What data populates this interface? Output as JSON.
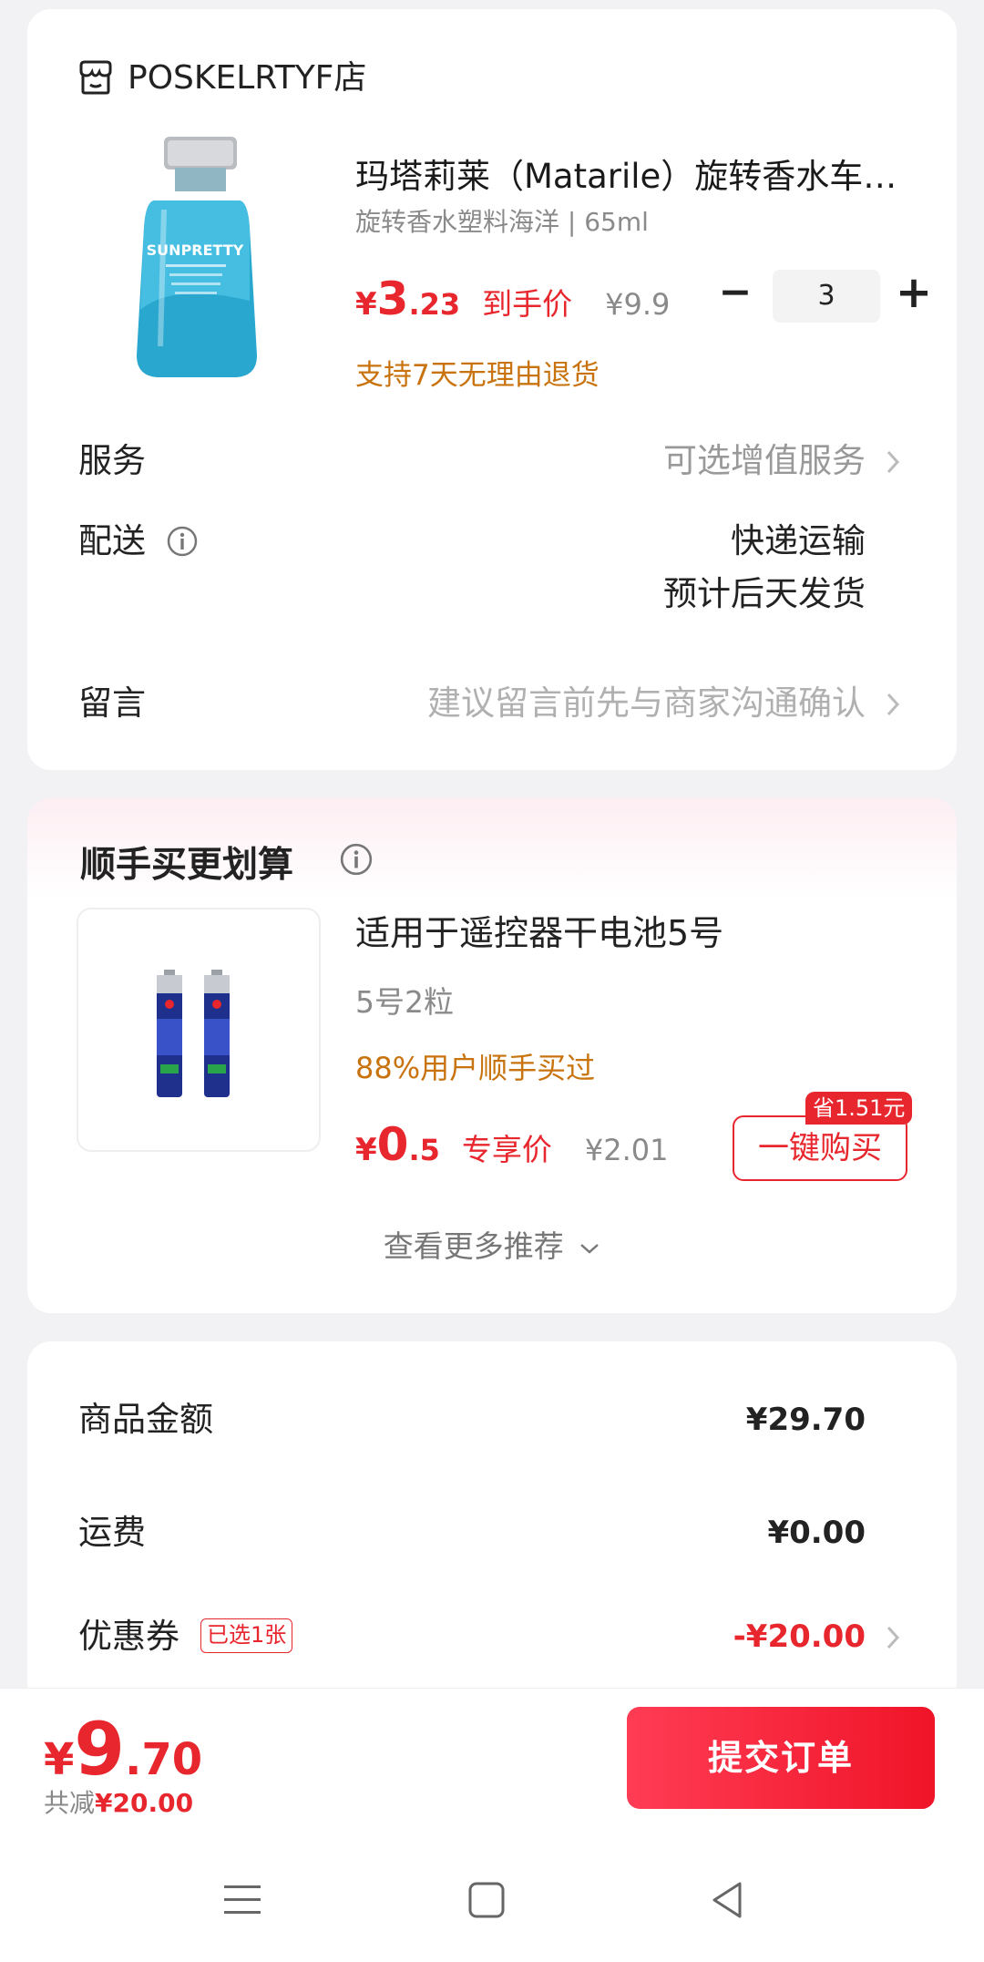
{
  "store": {
    "name": "POSKELRTYF店"
  },
  "product": {
    "title": "玛塔莉莱（Matarile）旋转香水车…",
    "spec": "旋转香水塑料海洋 | 65ml",
    "price_symbol": "¥",
    "price_int": "3",
    "price_dec": ".23",
    "price_tag": "到手价",
    "original_price": "¥9.9",
    "quantity": "3",
    "minus_symbol": "−",
    "plus_symbol": "+",
    "return_note": "支持7天无理由退货",
    "image_label": "SUNPRETTY"
  },
  "rows": {
    "service_label": "服务",
    "service_value": "可选增值服务",
    "delivery_label": "配送",
    "delivery_method": "快递运输",
    "delivery_eta": "预计后天发货",
    "message_label": "留言",
    "message_placeholder": "建议留言前先与商家沟通确认"
  },
  "recommend": {
    "title": "顺手买更划算",
    "item": {
      "name": "适用于遥控器干电池5号",
      "spec": "5号2粒",
      "bought": "88%用户顺手买过",
      "price_symbol": "¥",
      "price_int": "0",
      "price_dec": ".5",
      "price_tag": "专享价",
      "original_price": "¥2.01",
      "save_badge": "省1.51元",
      "buy_label": "一键购买"
    },
    "see_more": "查看更多推荐"
  },
  "summary": {
    "goods_label": "商品金额",
    "goods_value": "¥29.70",
    "shipping_label": "运费",
    "shipping_value": "¥0.00",
    "coupon_label": "优惠券",
    "coupon_badge": "已选1张",
    "coupon_value": "-¥20.00"
  },
  "bottom": {
    "total_symbol": "¥",
    "total_int": "9",
    "total_dec": ".70",
    "saved_prefix": "共减",
    "saved_value": "¥20.00",
    "submit_label": "提交订单"
  },
  "colors": {
    "accent_red": "#e8262d",
    "orange": "#c8730e",
    "background": "#f2f2f4"
  }
}
